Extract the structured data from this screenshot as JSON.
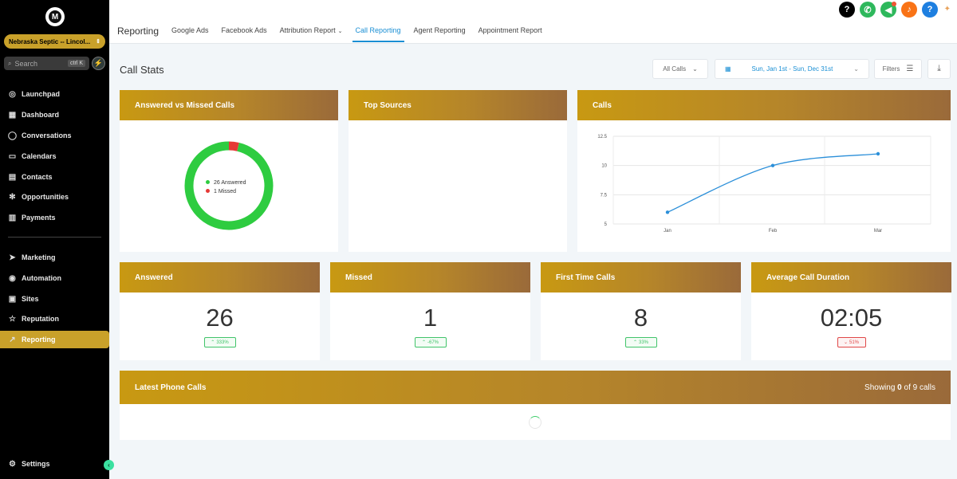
{
  "sidebar": {
    "logo": "M",
    "account": "Nebraska Septic -- Lincol...",
    "search_placeholder": "Search",
    "search_shortcut": "ctrl K",
    "items": [
      {
        "label": "Launchpad",
        "icon": "rocket-icon"
      },
      {
        "label": "Dashboard",
        "icon": "grid-icon"
      },
      {
        "label": "Conversations",
        "icon": "chat-icon"
      },
      {
        "label": "Calendars",
        "icon": "calendar-icon"
      },
      {
        "label": "Contacts",
        "icon": "contacts-icon"
      },
      {
        "label": "Opportunities",
        "icon": "network-icon"
      },
      {
        "label": "Payments",
        "icon": "payments-icon"
      },
      {
        "label": "Marketing",
        "icon": "send-icon"
      },
      {
        "label": "Automation",
        "icon": "automation-icon"
      },
      {
        "label": "Sites",
        "icon": "sites-icon"
      },
      {
        "label": "Reputation",
        "icon": "star-icon"
      },
      {
        "label": "Reporting",
        "icon": "trend-icon"
      }
    ],
    "settings": "Settings"
  },
  "header": {
    "title": "Reporting",
    "tabs": [
      "Google Ads",
      "Facebook Ads",
      "Attribution Report",
      "Call Reporting",
      "Agent Reporting",
      "Appointment Report"
    ],
    "active_tab": "Call Reporting"
  },
  "topbar_icons": [
    {
      "name": "help-dark-icon",
      "glyph": "?",
      "color": "#000000"
    },
    {
      "name": "phone-icon",
      "glyph": "✆",
      "color": "#2eb85c"
    },
    {
      "name": "megaphone-icon",
      "glyph": "◀",
      "color": "#2eb85c"
    },
    {
      "name": "bell-icon",
      "glyph": "♪",
      "color": "#f97316"
    },
    {
      "name": "help-blue-icon",
      "glyph": "?",
      "color": "#1e7fe0"
    }
  ],
  "page": {
    "title": "Call Stats",
    "calls_filter": "All Calls",
    "date_range": "Sun, Jan 1st - Sun, Dec 31st",
    "filters": "Filters"
  },
  "cards": {
    "answered_vs_missed": {
      "title": "Answered vs Missed Calls",
      "legend": [
        "26 Answered",
        "1 Missed"
      ]
    },
    "top_sources": {
      "title": "Top Sources"
    },
    "calls": {
      "title": "Calls"
    }
  },
  "stats": [
    {
      "title": "Answered",
      "value": "26",
      "delta": "333%",
      "trend": "up"
    },
    {
      "title": "Missed",
      "value": "1",
      "delta": "-67%",
      "trend": "up"
    },
    {
      "title": "First Time Calls",
      "value": "8",
      "delta": "33%",
      "trend": "up"
    },
    {
      "title": "Average Call Duration",
      "value": "02:05",
      "delta": "51%",
      "trend": "down"
    }
  ],
  "latest_calls": {
    "title": "Latest Phone Calls",
    "showing_prefix": "Showing",
    "showing_count": "0",
    "showing_mid": "of",
    "showing_total": "9 calls"
  },
  "colors": {
    "accent": "#c9a12a",
    "link": "#1a8fd4",
    "answered": "#2ecc40",
    "missed": "#e53935",
    "line": "#2b8fd9"
  },
  "chart_data": [
    {
      "type": "pie",
      "categories": [
        "Answered",
        "Missed"
      ],
      "values": [
        26,
        1
      ],
      "title": "Answered vs Missed Calls"
    },
    {
      "type": "line",
      "title": "Calls",
      "categories": [
        "Jan",
        "Feb",
        "Mar"
      ],
      "values": [
        6,
        10,
        11
      ],
      "ylim": [
        5,
        12.5
      ],
      "yticks": [
        "12.5",
        "10",
        "7.5",
        "5"
      ],
      "grid": true
    }
  ]
}
